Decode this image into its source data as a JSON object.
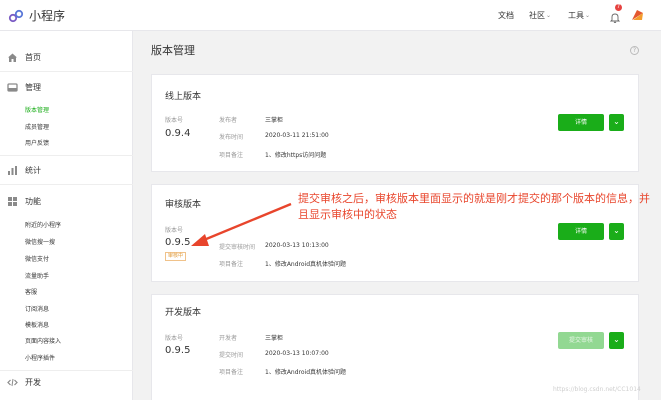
{
  "app": {
    "title": "小程序"
  },
  "topbar": {
    "docs": "文档",
    "community": "社区",
    "tools": "工具",
    "notification_count": "7"
  },
  "sidebar": {
    "home": "首页",
    "manage": "管理",
    "manage_items": [
      "版本管理",
      "成员管理",
      "用户反馈"
    ],
    "stats": "统计",
    "features": "功能",
    "feature_items": [
      "附近的小程序",
      "微信搜一搜",
      "微信支付",
      "客服",
      "订阅消息",
      "模板消息",
      "页面内容接入",
      "小程序插件"
    ],
    "feature_items_extra": "流量助手",
    "develop": "开发"
  },
  "main": {
    "title": "版本管理",
    "help": "?",
    "online": {
      "title": "线上版本",
      "version_label": "版本号",
      "version": "0.9.4",
      "publisher_label": "发布者",
      "publisher": "三掌柜",
      "time_label": "发布时间",
      "time": "2020-03-11 21:51:00",
      "note_label": "项目备注",
      "note": "1、修改https访问问题",
      "detail_btn": "详情",
      "dropdown": "⌄"
    },
    "review": {
      "title": "审核版本",
      "version_label": "版本号",
      "version": "0.9.5",
      "status": "审核中",
      "time_label": "提交审核时间",
      "time": "2020-03-13 10:13:00",
      "note_label": "项目备注",
      "note": "1、修改Android真机体验问题",
      "detail_btn": "详情",
      "dropdown": "⌄"
    },
    "dev": {
      "title": "开发版本",
      "version_label": "版本号",
      "version": "0.9.5",
      "dev_label": "开发者",
      "developer": "三掌柜",
      "time_label": "提交时间",
      "time": "2020-03-13 10:07:00",
      "note_label": "项目备注",
      "note": "1、修改Android真机体验问题",
      "submit_btn": "提交审核",
      "dropdown": "⌄"
    }
  },
  "annotation": "提交审核之后，审核版本里面显示的就是刚才提交的那个版本的信息，并且显示审核中的状态",
  "watermark": "https://blog.csdn.net/CC1014",
  "colors": {
    "accent": "#1aad19",
    "annotation": "#e8452c",
    "badge": "#e64340"
  }
}
